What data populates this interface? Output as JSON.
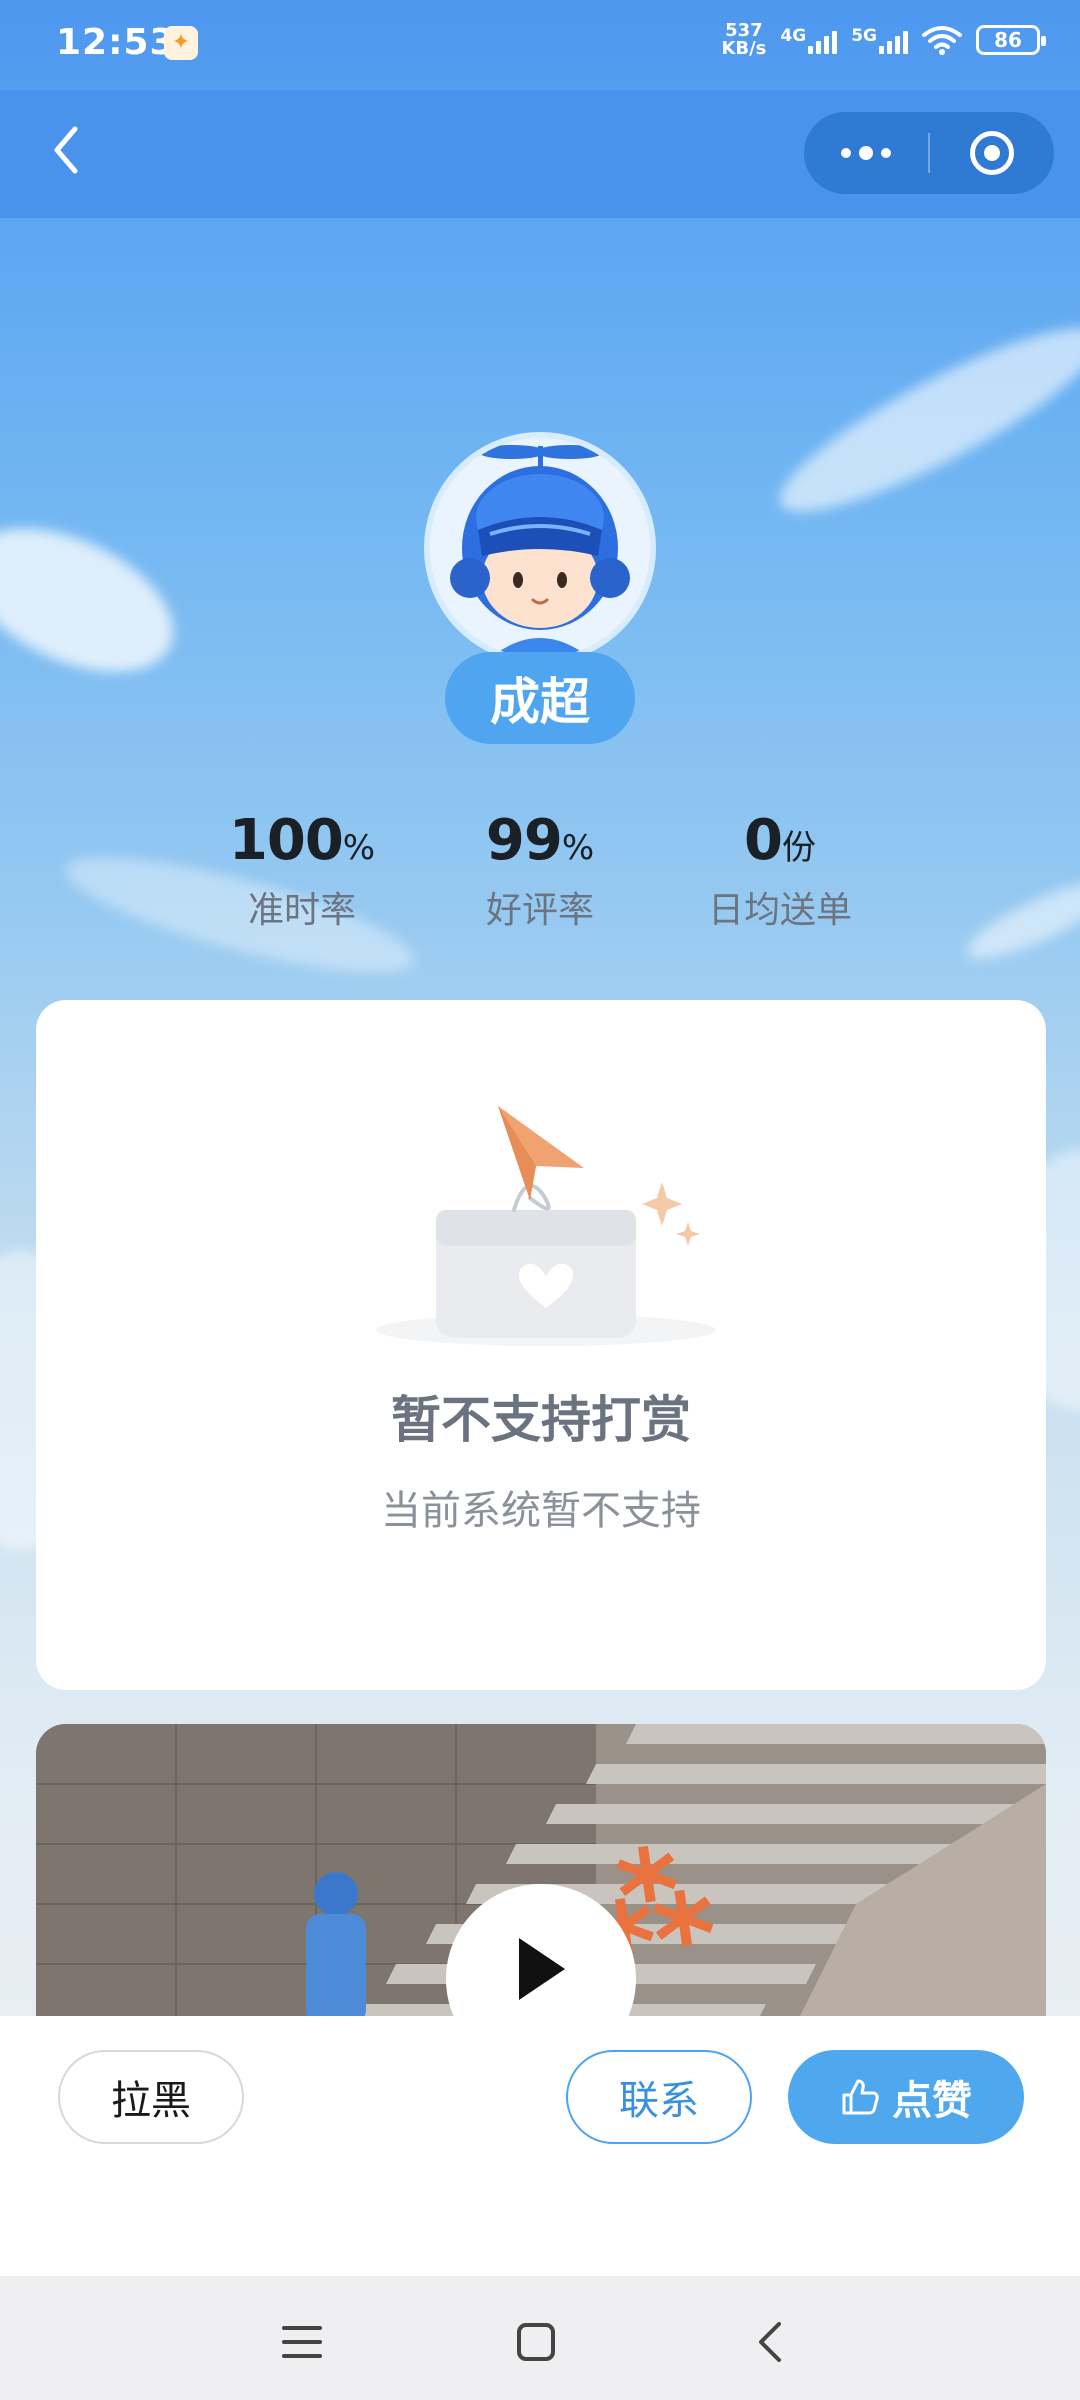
{
  "status_bar": {
    "time": "12:53",
    "speed_value": "537",
    "speed_unit": "KB/s",
    "net1": "4G",
    "net2": "5G",
    "battery": "86"
  },
  "navbar": {
    "back_icon": "chevron-left-icon",
    "more_icon": "more-dots-icon",
    "close_icon": "target-circle-icon"
  },
  "profile": {
    "name": "成超"
  },
  "stats": [
    {
      "value": "100",
      "unit": "%",
      "label": "准时率"
    },
    {
      "value": "99",
      "unit": "%",
      "label": "好评率"
    },
    {
      "value": "0",
      "unit": "份",
      "label": "日均送单"
    }
  ],
  "reward_card": {
    "title": "暂不支持打赏",
    "subtitle": "当前系统暂不支持"
  },
  "actions": {
    "block_label": "拉黑",
    "contact_label": "联系",
    "like_label": "点赞"
  },
  "colors": {
    "accent": "#4fa8ee",
    "navbar": "#4a93ec"
  }
}
